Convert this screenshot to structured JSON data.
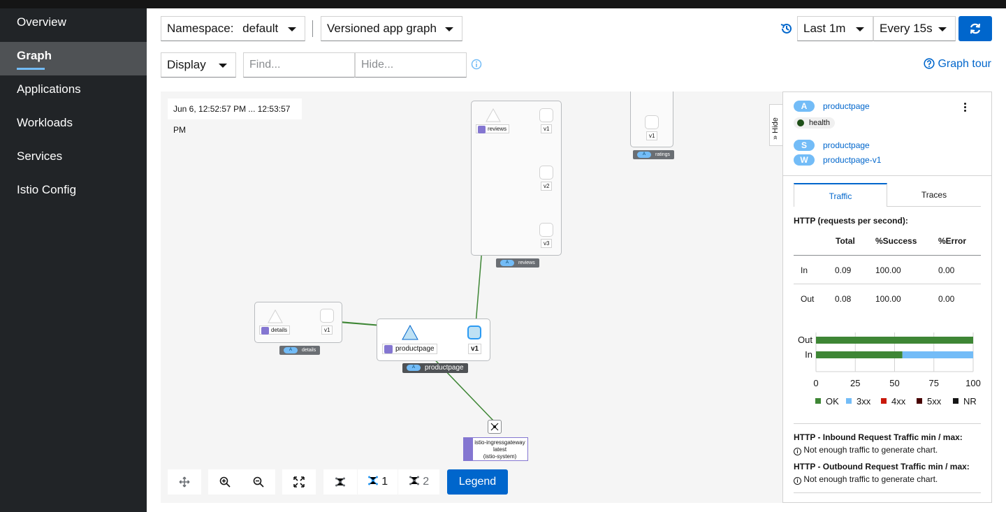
{
  "sidebar": {
    "items": [
      {
        "label": "Overview",
        "active": false
      },
      {
        "label": "Graph",
        "active": true
      },
      {
        "label": "Applications",
        "active": false
      },
      {
        "label": "Workloads",
        "active": false
      },
      {
        "label": "Services",
        "active": false
      },
      {
        "label": "Istio Config",
        "active": false
      }
    ]
  },
  "toolbar": {
    "namespace_label": "Namespace:",
    "namespace_value": "default",
    "graph_type": "Versioned app graph",
    "duration": "Last 1m",
    "refresh_interval": "Every 15s",
    "display_label": "Display",
    "find_placeholder": "Find...",
    "hide_placeholder": "Hide...",
    "graph_tour": "Graph tour"
  },
  "graph": {
    "timestamp": "Jun 6, 12:52:57 PM ... 12:53:57 PM",
    "reviews": {
      "app": "reviews",
      "versions": [
        "v1",
        "v2",
        "v3"
      ],
      "group": "reviews"
    },
    "ratings": {
      "version": "v1",
      "group": "ratings"
    },
    "details": {
      "app": "details",
      "version": "v1",
      "group": "details"
    },
    "productpage": {
      "app": "productpage",
      "version": "v1",
      "group": "productpage"
    },
    "gateway": {
      "line1": "istio-ingressgateway",
      "line2": "latest",
      "line3": "(istio-system)"
    },
    "group_badge": "A",
    "layout1": "1",
    "layout2": "2",
    "legend": "Legend"
  },
  "panel": {
    "hide": "Hide",
    "app_badge": "A",
    "app_name": "productpage",
    "health": "health",
    "svc_badge": "S",
    "svc_name": "productpage",
    "wl_badge": "W",
    "wl_name": "productpage-v1",
    "tabs": [
      "Traffic",
      "Traces"
    ],
    "http_title": "HTTP (requests per second):",
    "table": {
      "headers": [
        "",
        "Total",
        "%Success",
        "%Error"
      ],
      "rows": [
        [
          "In",
          "0.09",
          "100.00",
          "0.00"
        ],
        [
          "Out",
          "0.08",
          "100.00",
          "0.00"
        ]
      ]
    },
    "chart_labels": {
      "out": "Out",
      "in": "In"
    },
    "ticks": [
      "0",
      "25",
      "50",
      "75",
      "100"
    ],
    "legend": [
      {
        "label": "OK",
        "color": "#3e8635"
      },
      {
        "label": "3xx",
        "color": "#73bcf7"
      },
      {
        "label": "4xx",
        "color": "#c9190b"
      },
      {
        "label": "5xx",
        "color": "#470000"
      },
      {
        "label": "NR",
        "color": "#151515"
      }
    ],
    "inbound_title": "HTTP - Inbound Request Traffic min / max:",
    "inbound_msg": "Not enough traffic to generate chart.",
    "outbound_title": "HTTP - Outbound Request Traffic min / max:",
    "outbound_msg": "Not enough traffic to generate chart."
  },
  "chart_data": {
    "type": "bar",
    "categories": [
      "Out",
      "In"
    ],
    "series": [
      {
        "name": "OK",
        "values": [
          100,
          55
        ]
      },
      {
        "name": "3xx",
        "values": [
          0,
          45
        ]
      },
      {
        "name": "4xx",
        "values": [
          0,
          0
        ]
      },
      {
        "name": "5xx",
        "values": [
          0,
          0
        ]
      },
      {
        "name": "NR",
        "values": [
          0,
          0
        ]
      }
    ],
    "xlim": [
      0,
      100
    ],
    "orientation": "horizontal",
    "stacked": true,
    "legend": "bottom"
  }
}
